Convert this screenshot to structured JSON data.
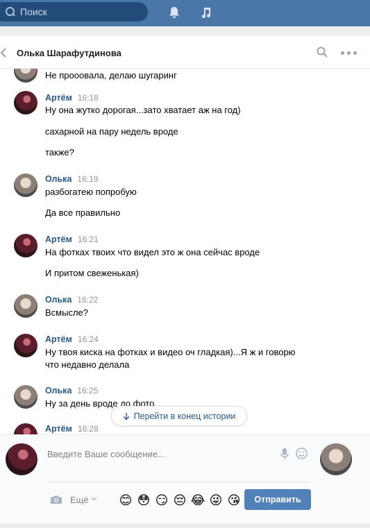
{
  "topbar": {
    "search_placeholder": "Поиск",
    "icons": [
      "search-icon",
      "bell-icon",
      "music-icon"
    ],
    "colors": {
      "bar": "#4a76a8",
      "search_bg": "#224b7a"
    }
  },
  "header": {
    "title": "Олька Шарафутдинова",
    "icons": [
      "back-icon",
      "search-icon",
      "more-icon"
    ]
  },
  "messages": [
    {
      "partial": true,
      "lines": [
        "Не прооовала, делаю шугаринг"
      ]
    },
    {
      "author": "Артём",
      "time": "16:18",
      "lines": [
        "Ну она жутко дорогая...зато хватает аж на год)",
        "сахарной на пару недель вроде",
        "также?"
      ]
    },
    {
      "author": "Олька",
      "time": "16:19",
      "lines": [
        "разбогатею попробую",
        "Да все правильно"
      ]
    },
    {
      "author": "Артём",
      "time": "16:21",
      "lines": [
        "На фотках твоих что видел это ж она сейчас вроде",
        "И притом свеженькая)"
      ]
    },
    {
      "author": "Олька",
      "time": "16:22",
      "lines": [
        "Всмысле?"
      ]
    },
    {
      "author": "Артём",
      "time": "16:24",
      "lines": [
        "Ну твоя киска на фотках и видео оч гладкая)...Я ж и говорю",
        "что недавно делала"
      ]
    },
    {
      "author": "Олька",
      "time": "16:25",
      "lines": [
        "Ну за день вроде до фото"
      ]
    },
    {
      "author": "Артём",
      "time": "16:28",
      "lines": []
    }
  ],
  "jump_button": {
    "label": "Перейти в конец истории",
    "icon": "arrow-down-icon"
  },
  "composer": {
    "placeholder": "Введите Ваше сообщение...",
    "more_label": "Ещё",
    "send_label": "Отправить",
    "emojis": [
      "😊",
      "😳",
      "😏",
      "😔",
      "😂",
      "😜",
      "😘"
    ],
    "icons": [
      "microphone-icon",
      "smile-icon",
      "camera-icon",
      "chevron-down-icon"
    ],
    "colors": {
      "send": "#5181b8",
      "link": "#2a5885"
    }
  }
}
